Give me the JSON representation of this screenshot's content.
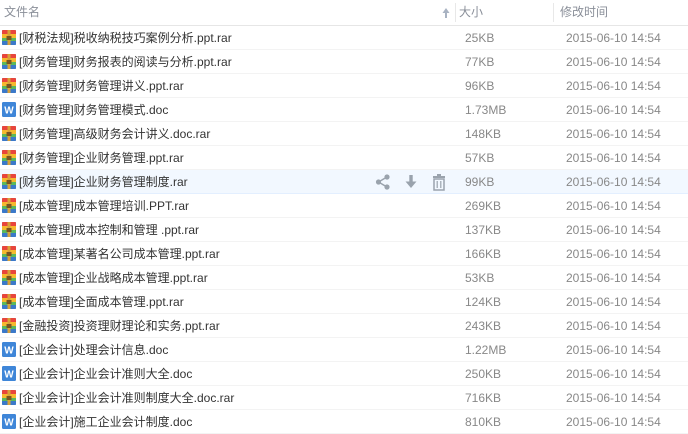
{
  "header": {
    "name_label": "文件名",
    "size_label": "大小",
    "mtime_label": "修改时间",
    "sort_icon": "sort-up-arrow-icon"
  },
  "row_actions": {
    "share_icon": "share-icon",
    "download_icon": "download-icon",
    "delete_icon": "trash-icon"
  },
  "files": [
    {
      "name": "[财税法规]税收纳税技巧案例分析.ppt.rar",
      "size": "25KB",
      "mtime": "2015-06-10 14:54",
      "type": "rar"
    },
    {
      "name": "[财务管理]财务报表的阅读与分析.ppt.rar",
      "size": "77KB",
      "mtime": "2015-06-10 14:54",
      "type": "rar"
    },
    {
      "name": "[财务管理]财务管理讲义.ppt.rar",
      "size": "96KB",
      "mtime": "2015-06-10 14:54",
      "type": "rar"
    },
    {
      "name": "[财务管理]财务管理模式.doc",
      "size": "1.73MB",
      "mtime": "2015-06-10 14:54",
      "type": "doc"
    },
    {
      "name": "[财务管理]高级财务会计讲义.doc.rar",
      "size": "148KB",
      "mtime": "2015-06-10 14:54",
      "type": "rar"
    },
    {
      "name": "[财务管理]企业财务管理.ppt.rar",
      "size": "57KB",
      "mtime": "2015-06-10 14:54",
      "type": "rar"
    },
    {
      "name": "[财务管理]企业财务管理制度.rar",
      "size": "99KB",
      "mtime": "2015-06-10 14:54",
      "type": "rar",
      "hover": true
    },
    {
      "name": "[成本管理]成本管理培训.PPT.rar",
      "size": "269KB",
      "mtime": "2015-06-10 14:54",
      "type": "rar"
    },
    {
      "name": "[成本管理]成本控制和管理 .ppt.rar",
      "size": "137KB",
      "mtime": "2015-06-10 14:54",
      "type": "rar"
    },
    {
      "name": "[成本管理]某著名公司成本管理.ppt.rar",
      "size": "166KB",
      "mtime": "2015-06-10 14:54",
      "type": "rar"
    },
    {
      "name": "[成本管理]企业战略成本管理.ppt.rar",
      "size": "53KB",
      "mtime": "2015-06-10 14:54",
      "type": "rar"
    },
    {
      "name": "[成本管理]全面成本管理.ppt.rar",
      "size": "124KB",
      "mtime": "2015-06-10 14:54",
      "type": "rar"
    },
    {
      "name": "[金融投资]投资理财理论和实务.ppt.rar",
      "size": "243KB",
      "mtime": "2015-06-10 14:54",
      "type": "rar"
    },
    {
      "name": "[企业会计]处理会计信息.doc",
      "size": "1.22MB",
      "mtime": "2015-06-10 14:54",
      "type": "doc"
    },
    {
      "name": "[企业会计]企业会计准则大全.doc",
      "size": "250KB",
      "mtime": "2015-06-10 14:54",
      "type": "doc"
    },
    {
      "name": "[企业会计]企业会计准则制度大全.doc.rar",
      "size": "716KB",
      "mtime": "2015-06-10 14:54",
      "type": "rar"
    },
    {
      "name": "[企业会计]施工企业会计制度.doc",
      "size": "810KB",
      "mtime": "2015-06-10 14:54",
      "type": "doc"
    }
  ]
}
